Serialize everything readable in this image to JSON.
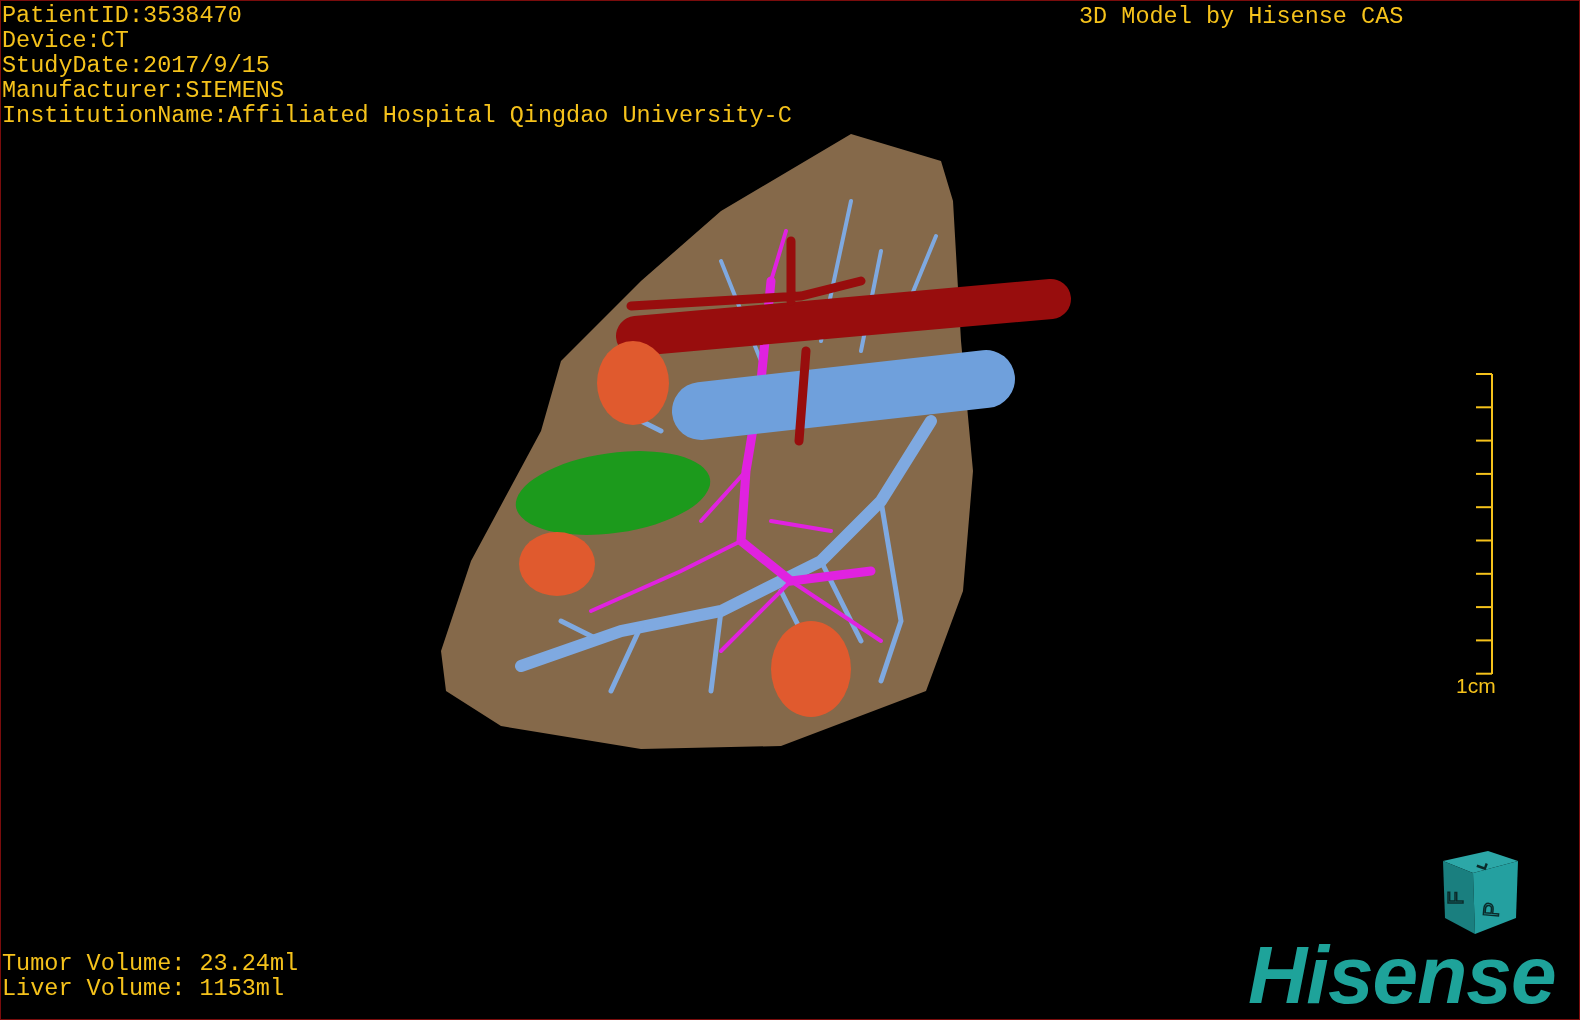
{
  "patient_info": [
    "PatientID:3538470",
    "Device:CT",
    "StudyDate:2017/9/15",
    "Manufacturer:SIEMENS",
    "InstitutionName:Affiliated Hospital Qingdao University-C"
  ],
  "title": "3D Model by Hisense CAS",
  "scale_label": "1cm",
  "volumes": [
    "Tumor Volume: 23.24ml",
    "Liver Volume: 1153ml"
  ],
  "orientation_cube": {
    "faces": [
      "L",
      "F",
      "P"
    ]
  },
  "logo": "Hisense"
}
